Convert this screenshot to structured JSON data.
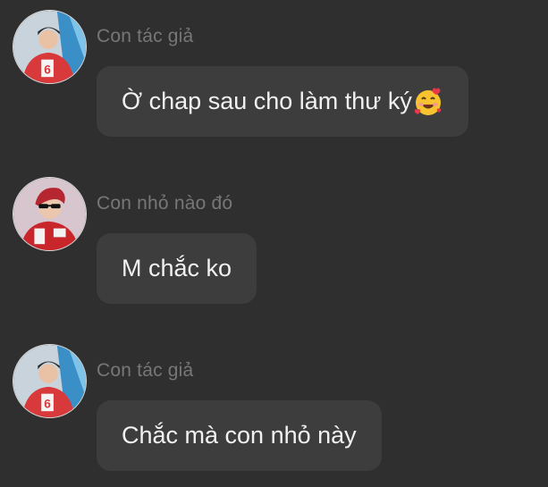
{
  "messages": [
    {
      "sender": "Con tác giả",
      "text": "Ờ chap sau cho làm thư ký",
      "emoji": "smiling-face-with-hearts-icon",
      "avatar": "author-avatar"
    },
    {
      "sender": "Con nhỏ nào đó",
      "text": "M chắc ko",
      "avatar": "reader-avatar"
    },
    {
      "sender": "Con tác giả",
      "text": "Chắc mà con nhỏ này",
      "avatar": "author-avatar"
    }
  ],
  "colors": {
    "background": "#2f2f2f",
    "bubble": "#3d3d3d",
    "sender_text": "#777777",
    "message_text": "#f1f1f1"
  }
}
